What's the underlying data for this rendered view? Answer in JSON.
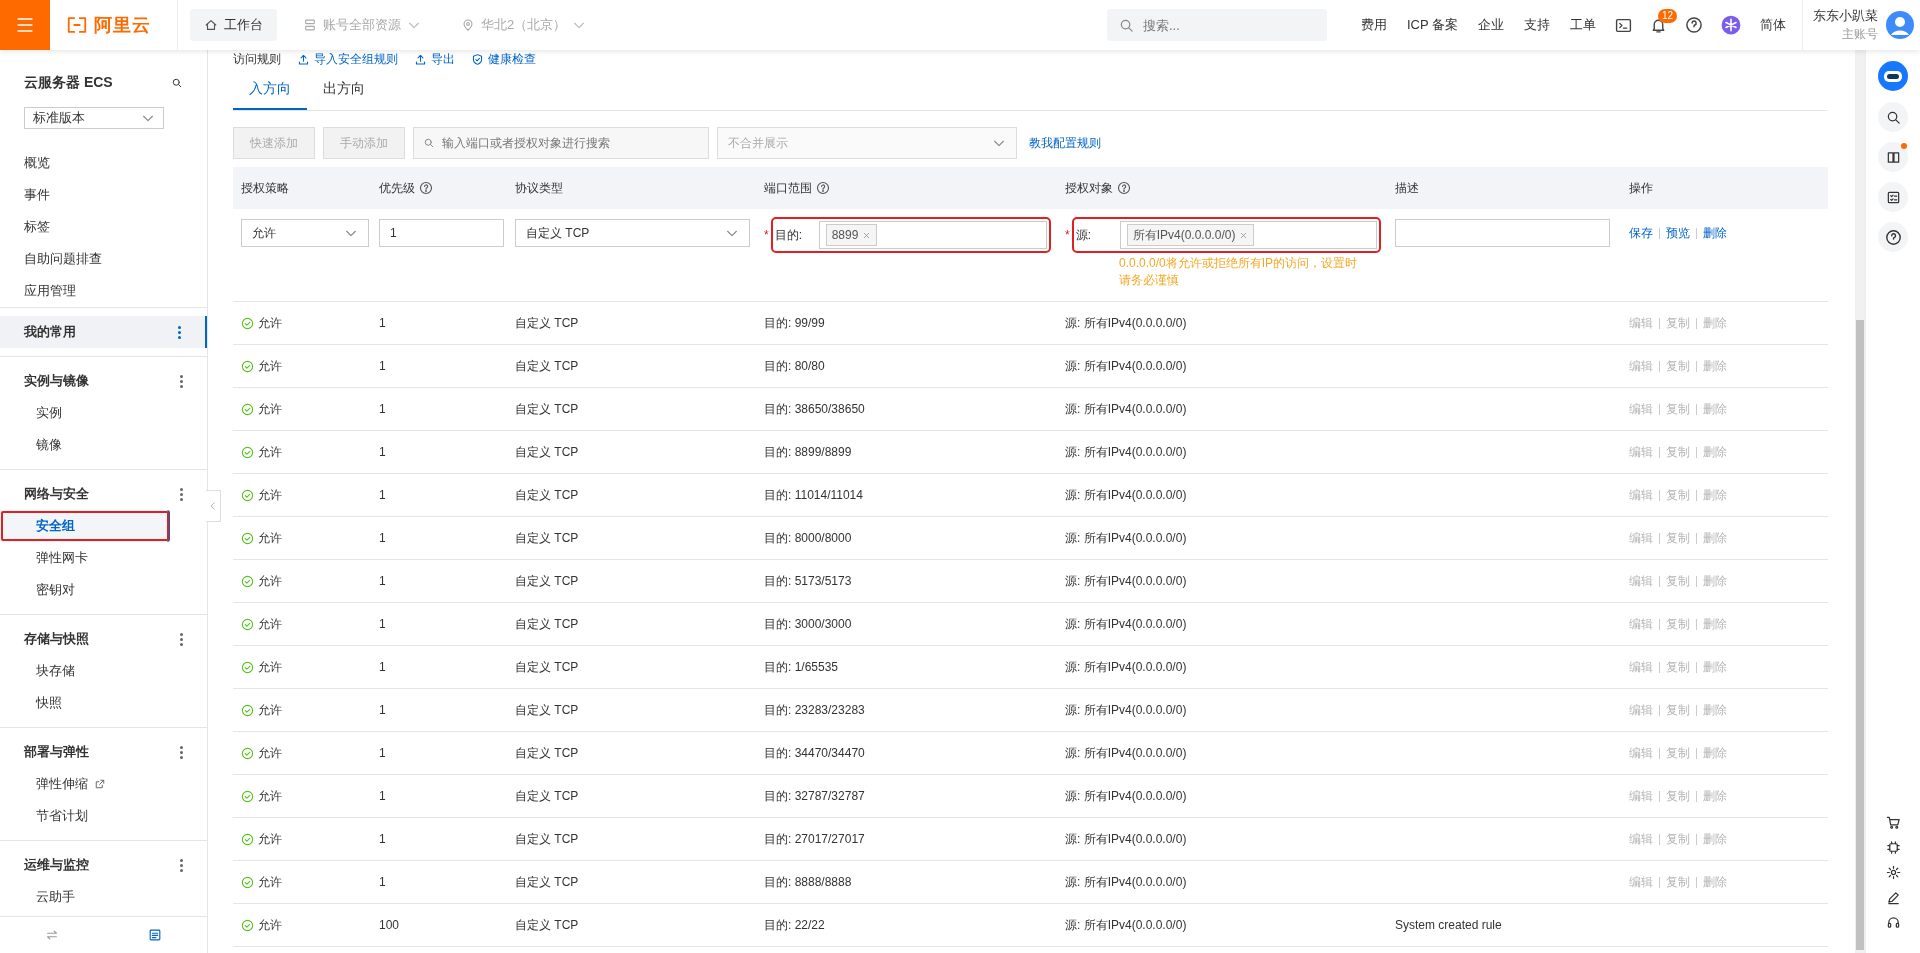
{
  "topbar": {
    "logo": "阿里云",
    "nav": [
      {
        "label": "工作台",
        "kind": "home",
        "selected": true
      },
      {
        "label": "账号全部资源",
        "kind": "resources",
        "selected": false
      },
      {
        "label": "华北2（北京）",
        "kind": "region",
        "selected": false
      }
    ],
    "search": {
      "placeholder": "搜索..."
    },
    "links": [
      "费用",
      "ICP 备案",
      "企业",
      "支持",
      "工单"
    ],
    "notifications": "12",
    "language": "简体",
    "user": {
      "name": "东东小趴菜",
      "role": "主账号"
    }
  },
  "sidebar": {
    "title": "云服务器 ECS",
    "edition": "标准版本",
    "items": [
      "概览",
      "事件",
      "标签",
      "自助问题排查",
      "应用管理"
    ],
    "groups": [
      {
        "title": "我的常用",
        "highlighted": true
      },
      {
        "title": "实例与镜像",
        "highlighted": false,
        "items": [
          {
            "label": "实例",
            "selected": false,
            "external": false,
            "annotated": false
          },
          {
            "label": "镜像",
            "selected": false,
            "external": false,
            "annotated": false
          }
        ]
      },
      {
        "title": "网络与安全",
        "highlighted": false,
        "items": [
          {
            "label": "安全组",
            "selected": true,
            "external": false,
            "annotated": true
          },
          {
            "label": "弹性网卡",
            "selected": false,
            "external": false,
            "annotated": false
          },
          {
            "label": "密钥对",
            "selected": false,
            "external": false,
            "annotated": false
          }
        ]
      },
      {
        "title": "存储与快照",
        "highlighted": false,
        "items": [
          {
            "label": "块存储",
            "selected": false,
            "external": false,
            "annotated": false
          },
          {
            "label": "快照",
            "selected": false,
            "external": false,
            "annotated": false
          }
        ]
      },
      {
        "title": "部署与弹性",
        "highlighted": false,
        "items": [
          {
            "label": "弹性伸缩",
            "selected": false,
            "external": true,
            "annotated": false
          },
          {
            "label": "节省计划",
            "selected": false,
            "external": false,
            "annotated": false
          }
        ]
      },
      {
        "title": "运维与监控",
        "highlighted": false,
        "items": [
          {
            "label": "云助手",
            "selected": false,
            "external": false,
            "annotated": false
          }
        ]
      }
    ]
  },
  "content": {
    "header_links": [
      {
        "label": "访问规则",
        "kind": "text"
      },
      {
        "label": "导入安全组规则",
        "kind": "import"
      },
      {
        "label": "导出",
        "kind": "export"
      },
      {
        "label": "健康检查",
        "kind": "check"
      }
    ],
    "tabs": [
      {
        "label": "入方向",
        "selected": true
      },
      {
        "label": "出方向",
        "selected": false
      }
    ],
    "toolbar": {
      "buttons": [
        {
          "label": "快速添加",
          "disabled": true
        },
        {
          "label": "手动添加",
          "disabled": true
        }
      ],
      "search": {
        "placeholder": "输入端口或者授权对象进行搜索"
      },
      "merge_select": "不合并展示",
      "help_link": "教我配置规则"
    },
    "table": {
      "columns": [
        {
          "label": "授权策略",
          "help": false
        },
        {
          "label": "优先级",
          "help": true
        },
        {
          "label": "协议类型",
          "help": false
        },
        {
          "label": "端口范围",
          "help": true
        },
        {
          "label": "授权对象",
          "help": true
        },
        {
          "label": "描述",
          "help": false
        },
        {
          "label": "操作",
          "help": false
        }
      ],
      "edit_row": {
        "policy": "允许",
        "priority": "1",
        "protocol": "自定义 TCP",
        "port_mark": "*",
        "port_label": "目的:",
        "port_tag": "8899",
        "port_annotated": true,
        "source_mark": "*",
        "source_label": "源:",
        "source_tag": "所有IPv4(0.0.0.0/0)",
        "source_annotated": true,
        "hint": "0.0.0.0/0将允许或拒绝所有IP的访问，设置时请务必谨慎",
        "actions": [
          "保存",
          "预览",
          "删除"
        ]
      },
      "rows": [
        {
          "policy": "允许",
          "priority": "1",
          "protocol": "自定义 TCP",
          "port": "目的: 99/99",
          "source": "源: 所有IPv4(0.0.0.0/0)",
          "actions": [
            "编辑",
            "复制",
            "删除"
          ],
          "actions_disabled": true
        },
        {
          "policy": "允许",
          "priority": "1",
          "protocol": "自定义 TCP",
          "port": "目的: 80/80",
          "source": "源: 所有IPv4(0.0.0.0/0)",
          "actions": [
            "编辑",
            "复制",
            "删除"
          ],
          "actions_disabled": true
        },
        {
          "policy": "允许",
          "priority": "1",
          "protocol": "自定义 TCP",
          "port": "目的: 38650/38650",
          "source": "源: 所有IPv4(0.0.0.0/0)",
          "actions": [
            "编辑",
            "复制",
            "删除"
          ],
          "actions_disabled": true
        },
        {
          "policy": "允许",
          "priority": "1",
          "protocol": "自定义 TCP",
          "port": "目的: 8899/8899",
          "source": "源: 所有IPv4(0.0.0.0/0)",
          "actions": [
            "编辑",
            "复制",
            "删除"
          ],
          "actions_disabled": true
        },
        {
          "policy": "允许",
          "priority": "1",
          "protocol": "自定义 TCP",
          "port": "目的: 11014/11014",
          "source": "源: 所有IPv4(0.0.0.0/0)",
          "actions": [
            "编辑",
            "复制",
            "删除"
          ],
          "actions_disabled": true
        },
        {
          "policy": "允许",
          "priority": "1",
          "protocol": "自定义 TCP",
          "port": "目的: 8000/8000",
          "source": "源: 所有IPv4(0.0.0.0/0)",
          "actions": [
            "编辑",
            "复制",
            "删除"
          ],
          "actions_disabled": true
        },
        {
          "policy": "允许",
          "priority": "1",
          "protocol": "自定义 TCP",
          "port": "目的: 5173/5173",
          "source": "源: 所有IPv4(0.0.0.0/0)",
          "actions": [
            "编辑",
            "复制",
            "删除"
          ],
          "actions_disabled": true
        },
        {
          "policy": "允许",
          "priority": "1",
          "protocol": "自定义 TCP",
          "port": "目的: 3000/3000",
          "source": "源: 所有IPv4(0.0.0.0/0)",
          "actions": [
            "编辑",
            "复制",
            "删除"
          ],
          "actions_disabled": true
        },
        {
          "policy": "允许",
          "priority": "1",
          "protocol": "自定义 TCP",
          "port": "目的: 1/65535",
          "source": "源: 所有IPv4(0.0.0.0/0)",
          "actions": [
            "编辑",
            "复制",
            "删除"
          ],
          "actions_disabled": true
        },
        {
          "policy": "允许",
          "priority": "1",
          "protocol": "自定义 TCP",
          "port": "目的: 23283/23283",
          "source": "源: 所有IPv4(0.0.0.0/0)",
          "actions": [
            "编辑",
            "复制",
            "删除"
          ],
          "actions_disabled": true
        },
        {
          "policy": "允许",
          "priority": "1",
          "protocol": "自定义 TCP",
          "port": "目的: 34470/34470",
          "source": "源: 所有IPv4(0.0.0.0/0)",
          "actions": [
            "编辑",
            "复制",
            "删除"
          ],
          "actions_disabled": true
        },
        {
          "policy": "允许",
          "priority": "1",
          "protocol": "自定义 TCP",
          "port": "目的: 32787/32787",
          "source": "源: 所有IPv4(0.0.0.0/0)",
          "actions": [
            "编辑",
            "复制",
            "删除"
          ],
          "actions_disabled": true
        },
        {
          "policy": "允许",
          "priority": "1",
          "protocol": "自定义 TCP",
          "port": "目的: 27017/27017",
          "source": "源: 所有IPv4(0.0.0.0/0)",
          "actions": [
            "编辑",
            "复制",
            "删除"
          ],
          "actions_disabled": true
        },
        {
          "policy": "允许",
          "priority": "1",
          "protocol": "自定义 TCP",
          "port": "目的: 8888/8888",
          "source": "源: 所有IPv4(0.0.0.0/0)",
          "actions": [
            "编辑",
            "复制",
            "删除"
          ],
          "actions_disabled": true
        },
        {
          "policy": "允许",
          "priority": "100",
          "protocol": "自定义 TCP",
          "port": "目的: 22/22",
          "source": "源: 所有IPv4(0.0.0.0/0)",
          "description": "System created rule"
        }
      ]
    }
  }
}
